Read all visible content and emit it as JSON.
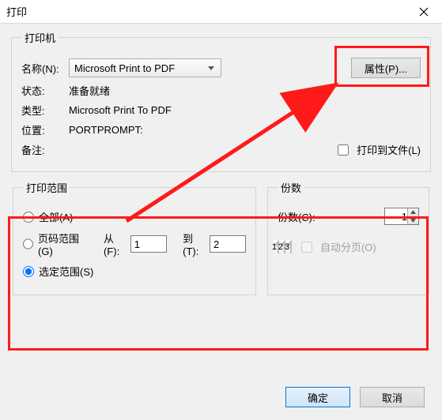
{
  "titlebar": {
    "title": "打印"
  },
  "printer": {
    "legend": "打印机",
    "name_label": "名称(N):",
    "name_value": "Microsoft Print to PDF",
    "properties_btn": "属性(P)...",
    "status_label": "状态:",
    "status_value": "准备就绪",
    "type_label": "类型:",
    "type_value": "Microsoft Print To PDF",
    "where_label": "位置:",
    "where_value": "PORTPROMPT:",
    "comment_label": "备注:",
    "comment_value": "",
    "print_to_file": "打印到文件(L)"
  },
  "range": {
    "legend": "打印范围",
    "all": "全部(A)",
    "pages": "页码范围(G)",
    "from_label": "从(F):",
    "from_value": "1",
    "to_label": "到(T):",
    "to_value": "2",
    "selection": "选定范围(S)"
  },
  "copies": {
    "legend": "份数",
    "count_label": "份数(C):",
    "count_value": "1",
    "collate": "自动分页(O)",
    "p1": "1",
    "p2": "2",
    "p3": "3"
  },
  "buttons": {
    "ok": "确定",
    "cancel": "取消"
  }
}
